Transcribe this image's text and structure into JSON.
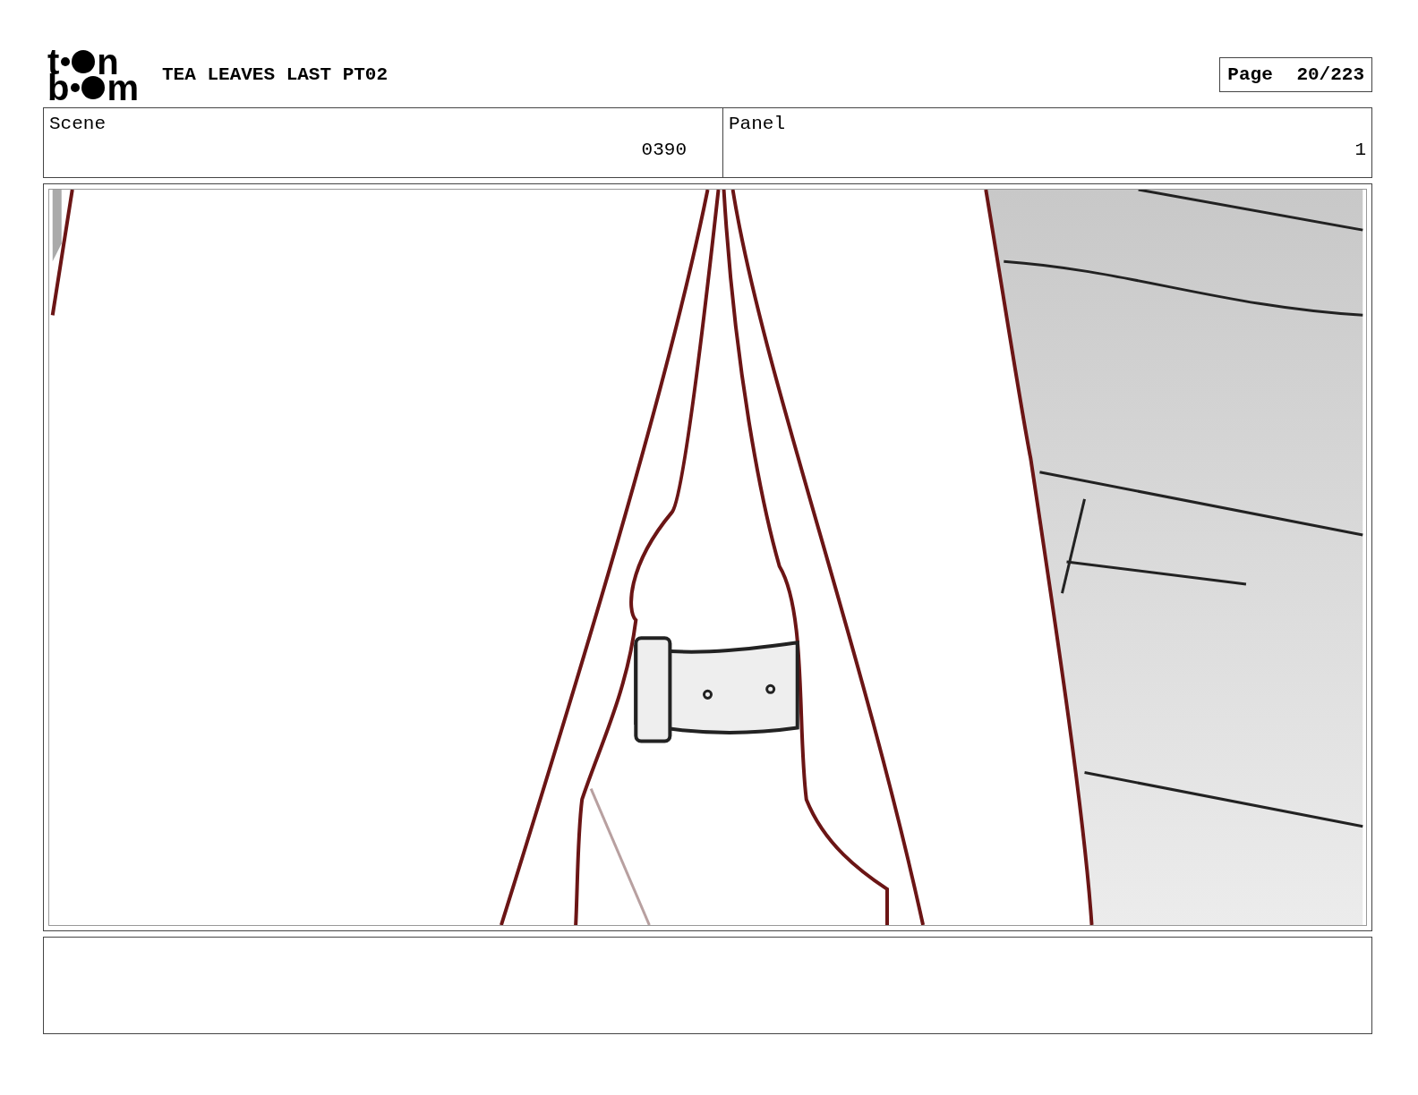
{
  "logo": {
    "lines": [
      [
        "t",
        "n"
      ],
      [
        "b",
        "m"
      ]
    ]
  },
  "title": "TEA LEAVES LAST PT02",
  "page": {
    "label": "Page",
    "value": "20/223"
  },
  "fields": [
    {
      "label": "Scene",
      "value": "0390"
    },
    {
      "label": "Panel",
      "value": "1"
    }
  ],
  "panel_image": {
    "kind": "sketch"
  }
}
